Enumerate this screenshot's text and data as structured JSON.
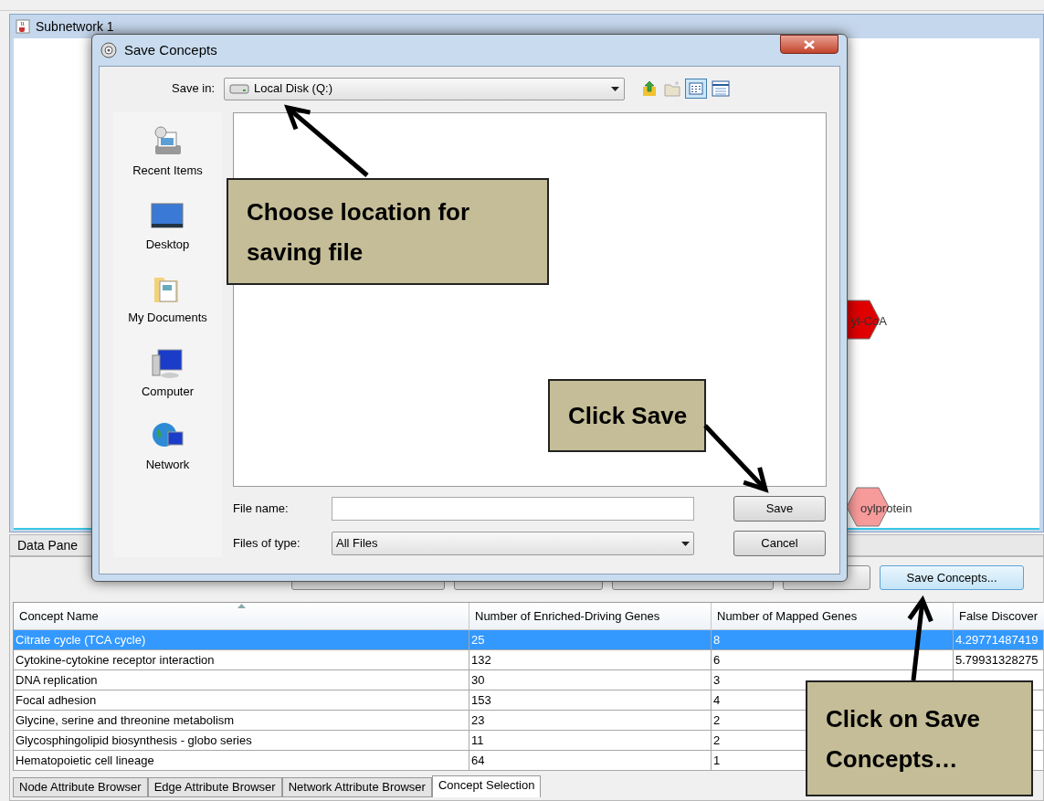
{
  "network_window": {
    "title": "Subnetwork 1",
    "nodes": [
      {
        "label": "yl-CoA",
        "color": "#e00000"
      },
      {
        "label": "oylprotein",
        "color": "#f79a9a"
      }
    ]
  },
  "data_panel": {
    "title": "Data Pane",
    "buttons": [
      {
        "label": "Save Concepts..."
      }
    ],
    "table": {
      "columns": [
        "Concept Name",
        "Number of Enriched-Driving Genes",
        "Number of Mapped Genes",
        "False Discover"
      ],
      "rows": [
        {
          "cells": [
            "Citrate cycle (TCA cycle)",
            "25",
            "8",
            "4.29771487419"
          ],
          "selected": true
        },
        {
          "cells": [
            "Cytokine-cytokine receptor interaction",
            "132",
            "6",
            "5.79931328275"
          ],
          "selected": false
        },
        {
          "cells": [
            "DNA replication",
            "30",
            "3"
          ],
          "selected": false
        },
        {
          "cells": [
            "Focal adhesion",
            "153",
            "4"
          ],
          "selected": false
        },
        {
          "cells": [
            "Glycine, serine and threonine metabolism",
            "23",
            "2"
          ],
          "selected": false
        },
        {
          "cells": [
            "Glycosphingolipid biosynthesis - globo series",
            "11",
            "2"
          ],
          "selected": false
        },
        {
          "cells": [
            "Hematopoietic cell lineage",
            "64",
            "1"
          ],
          "selected": false
        }
      ]
    },
    "tabs": [
      {
        "label": "Node Attribute Browser",
        "selected": false
      },
      {
        "label": "Edge Attribute Browser",
        "selected": false
      },
      {
        "label": "Network Attribute Browser",
        "selected": false
      },
      {
        "label": "Concept Selection",
        "selected": true
      }
    ]
  },
  "dialog": {
    "title": "Save Concepts",
    "save_in_label": "Save in:",
    "save_in_value": "Local Disk (Q:)",
    "places": [
      {
        "kind": "recent",
        "label": "Recent Items"
      },
      {
        "kind": "desktop",
        "label": "Desktop"
      },
      {
        "kind": "documents",
        "label": "My Documents"
      },
      {
        "kind": "computer",
        "label": "Computer"
      },
      {
        "kind": "network",
        "label": "Network"
      }
    ],
    "file_name_label": "File name:",
    "files_of_type_label": "Files of type:",
    "files_of_type_value": "All Files",
    "buttons": [
      {
        "label": "Save"
      },
      {
        "label": "Cancel"
      }
    ]
  },
  "callouts": [
    {
      "text": "Choose location for saving file"
    },
    {
      "text": "Click Save"
    },
    {
      "text": "Click on Save Concepts…"
    }
  ]
}
